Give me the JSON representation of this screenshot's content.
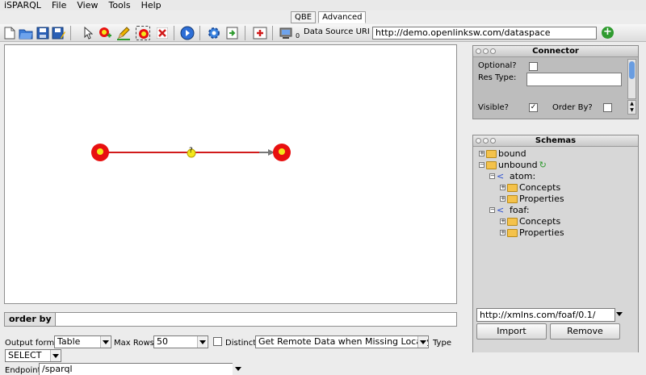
{
  "menu": [
    "iSPARQL",
    "File",
    "View",
    "Tools",
    "Help"
  ],
  "tabs": [
    {
      "label": "QBE"
    },
    {
      "label": "Advanced"
    }
  ],
  "toolbar": {
    "data_source_label": "Data Source URI",
    "data_source_value": "http://demo.openlinksw.com/dataspace",
    "badge": "0"
  },
  "graph": {
    "edge_label": "?",
    "nodes": [
      {
        "name": "subject-node"
      },
      {
        "name": "object-node"
      }
    ],
    "colors": {
      "node": "#e81010",
      "edge": "#d11b1b",
      "arrow": "#777777",
      "predicate": "#f3e81a"
    }
  },
  "orderby": {
    "label": "order by"
  },
  "bottom": {
    "output_format_label": "Output format",
    "output_format_value": "Table",
    "max_rows_label": "Max Rows",
    "max_rows_value": "50",
    "distinct_label": "Distinct",
    "remote_value": "Get Remote Data when Missing Locally",
    "type_label": "Type",
    "type_value": "SELECT",
    "endpoint_label": "Endpoint",
    "endpoint_value": "/sparql"
  },
  "connector": {
    "title": "Connector",
    "optional_label": "Optional?",
    "res_type_label": "Res Type:",
    "visible_label": "Visible?",
    "order_by_label": "Order By?",
    "visible_checked": true
  },
  "schemas": {
    "title": "Schemas",
    "items": [
      {
        "label": "bound",
        "level": 0
      },
      {
        "label": "unbound",
        "level": 0
      },
      {
        "label": "atom:",
        "level": 1
      },
      {
        "label": "Concepts",
        "level": 2
      },
      {
        "label": "Properties",
        "level": 2
      },
      {
        "label": "foaf:",
        "level": 1
      },
      {
        "label": "Concepts",
        "level": 2
      },
      {
        "label": "Properties",
        "level": 2
      }
    ],
    "uri_value": "http://xmlns.com/foaf/0.1/",
    "import_label": "Import",
    "remove_label": "Remove"
  }
}
